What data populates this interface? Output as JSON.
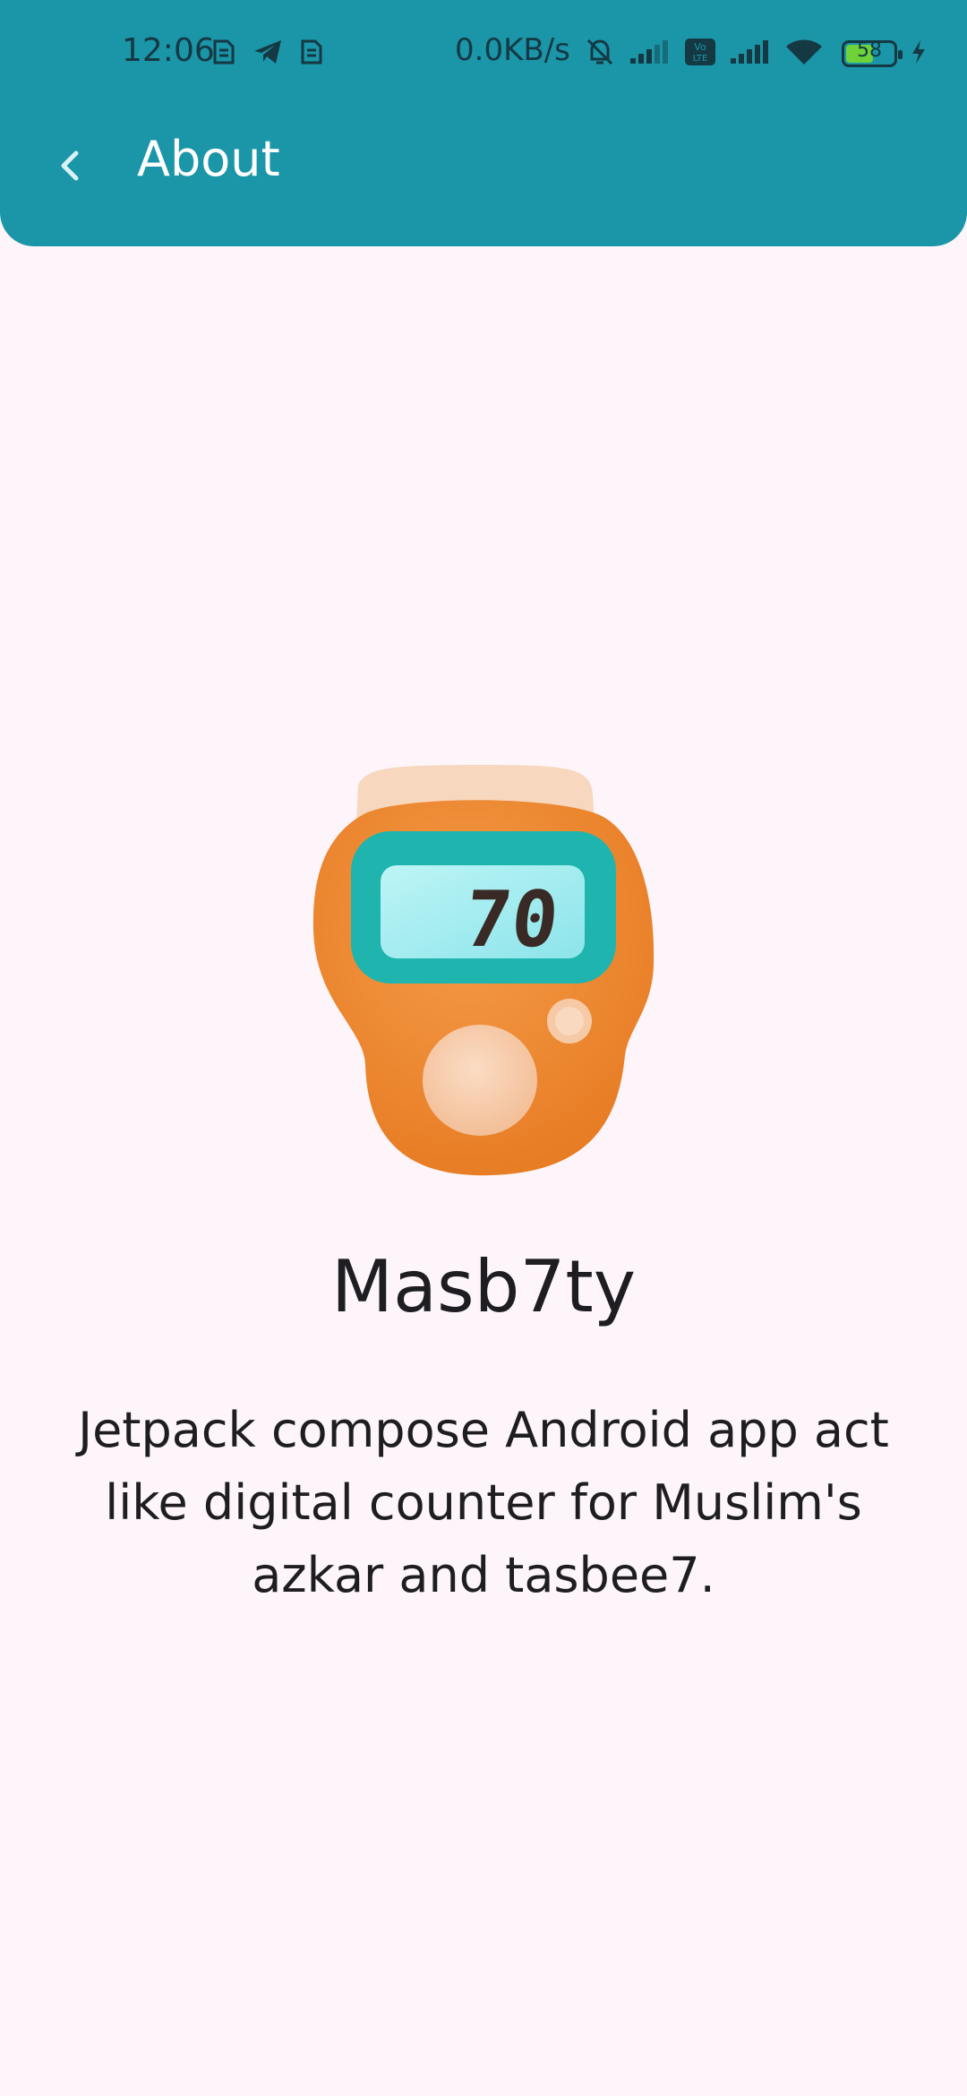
{
  "status_bar": {
    "time": "12:06",
    "network_speed": "0.0KB/s",
    "battery_percent": 58,
    "battery_text": "58",
    "icons": [
      "sim-card-icon",
      "telegram-icon",
      "sim-card-icon",
      "bell-off-icon",
      "signal-icon",
      "volte-icon",
      "signal-icon",
      "wifi-icon",
      "battery-icon",
      "charging-icon"
    ]
  },
  "header": {
    "title": "About",
    "back_icon": "chevron-left-icon",
    "background_color": "#1B95A8"
  },
  "app": {
    "counter_value": "70",
    "name": "Masb7ty",
    "description": "Jetpack compose Android app act like digital counter for Muslim's azkar and tasbee7."
  },
  "colors": {
    "background": "#FDF5FA",
    "accent": "#1B95A8",
    "counter_body": "#F08A2E",
    "counter_screen": "#1FB5AE"
  }
}
